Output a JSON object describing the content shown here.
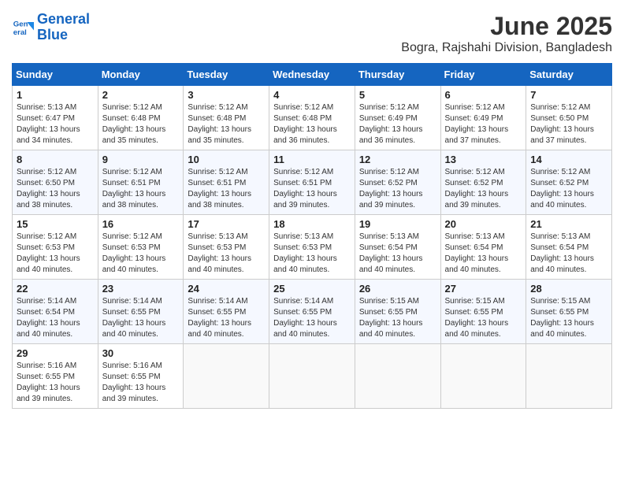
{
  "logo": {
    "line1": "General",
    "line2": "Blue"
  },
  "title": "June 2025",
  "subtitle": "Bogra, Rajshahi Division, Bangladesh",
  "headers": [
    "Sunday",
    "Monday",
    "Tuesday",
    "Wednesday",
    "Thursday",
    "Friday",
    "Saturday"
  ],
  "weeks": [
    [
      {
        "day": "1",
        "sunrise": "5:13 AM",
        "sunset": "6:47 PM",
        "daylight": "13 hours and 34 minutes."
      },
      {
        "day": "2",
        "sunrise": "5:12 AM",
        "sunset": "6:48 PM",
        "daylight": "13 hours and 35 minutes."
      },
      {
        "day": "3",
        "sunrise": "5:12 AM",
        "sunset": "6:48 PM",
        "daylight": "13 hours and 35 minutes."
      },
      {
        "day": "4",
        "sunrise": "5:12 AM",
        "sunset": "6:48 PM",
        "daylight": "13 hours and 36 minutes."
      },
      {
        "day": "5",
        "sunrise": "5:12 AM",
        "sunset": "6:49 PM",
        "daylight": "13 hours and 36 minutes."
      },
      {
        "day": "6",
        "sunrise": "5:12 AM",
        "sunset": "6:49 PM",
        "daylight": "13 hours and 37 minutes."
      },
      {
        "day": "7",
        "sunrise": "5:12 AM",
        "sunset": "6:50 PM",
        "daylight": "13 hours and 37 minutes."
      }
    ],
    [
      {
        "day": "8",
        "sunrise": "5:12 AM",
        "sunset": "6:50 PM",
        "daylight": "13 hours and 38 minutes."
      },
      {
        "day": "9",
        "sunrise": "5:12 AM",
        "sunset": "6:51 PM",
        "daylight": "13 hours and 38 minutes."
      },
      {
        "day": "10",
        "sunrise": "5:12 AM",
        "sunset": "6:51 PM",
        "daylight": "13 hours and 38 minutes."
      },
      {
        "day": "11",
        "sunrise": "5:12 AM",
        "sunset": "6:51 PM",
        "daylight": "13 hours and 39 minutes."
      },
      {
        "day": "12",
        "sunrise": "5:12 AM",
        "sunset": "6:52 PM",
        "daylight": "13 hours and 39 minutes."
      },
      {
        "day": "13",
        "sunrise": "5:12 AM",
        "sunset": "6:52 PM",
        "daylight": "13 hours and 39 minutes."
      },
      {
        "day": "14",
        "sunrise": "5:12 AM",
        "sunset": "6:52 PM",
        "daylight": "13 hours and 40 minutes."
      }
    ],
    [
      {
        "day": "15",
        "sunrise": "5:12 AM",
        "sunset": "6:53 PM",
        "daylight": "13 hours and 40 minutes."
      },
      {
        "day": "16",
        "sunrise": "5:12 AM",
        "sunset": "6:53 PM",
        "daylight": "13 hours and 40 minutes."
      },
      {
        "day": "17",
        "sunrise": "5:13 AM",
        "sunset": "6:53 PM",
        "daylight": "13 hours and 40 minutes."
      },
      {
        "day": "18",
        "sunrise": "5:13 AM",
        "sunset": "6:53 PM",
        "daylight": "13 hours and 40 minutes."
      },
      {
        "day": "19",
        "sunrise": "5:13 AM",
        "sunset": "6:54 PM",
        "daylight": "13 hours and 40 minutes."
      },
      {
        "day": "20",
        "sunrise": "5:13 AM",
        "sunset": "6:54 PM",
        "daylight": "13 hours and 40 minutes."
      },
      {
        "day": "21",
        "sunrise": "5:13 AM",
        "sunset": "6:54 PM",
        "daylight": "13 hours and 40 minutes."
      }
    ],
    [
      {
        "day": "22",
        "sunrise": "5:14 AM",
        "sunset": "6:54 PM",
        "daylight": "13 hours and 40 minutes."
      },
      {
        "day": "23",
        "sunrise": "5:14 AM",
        "sunset": "6:55 PM",
        "daylight": "13 hours and 40 minutes."
      },
      {
        "day": "24",
        "sunrise": "5:14 AM",
        "sunset": "6:55 PM",
        "daylight": "13 hours and 40 minutes."
      },
      {
        "day": "25",
        "sunrise": "5:14 AM",
        "sunset": "6:55 PM",
        "daylight": "13 hours and 40 minutes."
      },
      {
        "day": "26",
        "sunrise": "5:15 AM",
        "sunset": "6:55 PM",
        "daylight": "13 hours and 40 minutes."
      },
      {
        "day": "27",
        "sunrise": "5:15 AM",
        "sunset": "6:55 PM",
        "daylight": "13 hours and 40 minutes."
      },
      {
        "day": "28",
        "sunrise": "5:15 AM",
        "sunset": "6:55 PM",
        "daylight": "13 hours and 40 minutes."
      }
    ],
    [
      {
        "day": "29",
        "sunrise": "5:16 AM",
        "sunset": "6:55 PM",
        "daylight": "13 hours and 39 minutes."
      },
      {
        "day": "30",
        "sunrise": "5:16 AM",
        "sunset": "6:55 PM",
        "daylight": "13 hours and 39 minutes."
      },
      null,
      null,
      null,
      null,
      null
    ]
  ]
}
